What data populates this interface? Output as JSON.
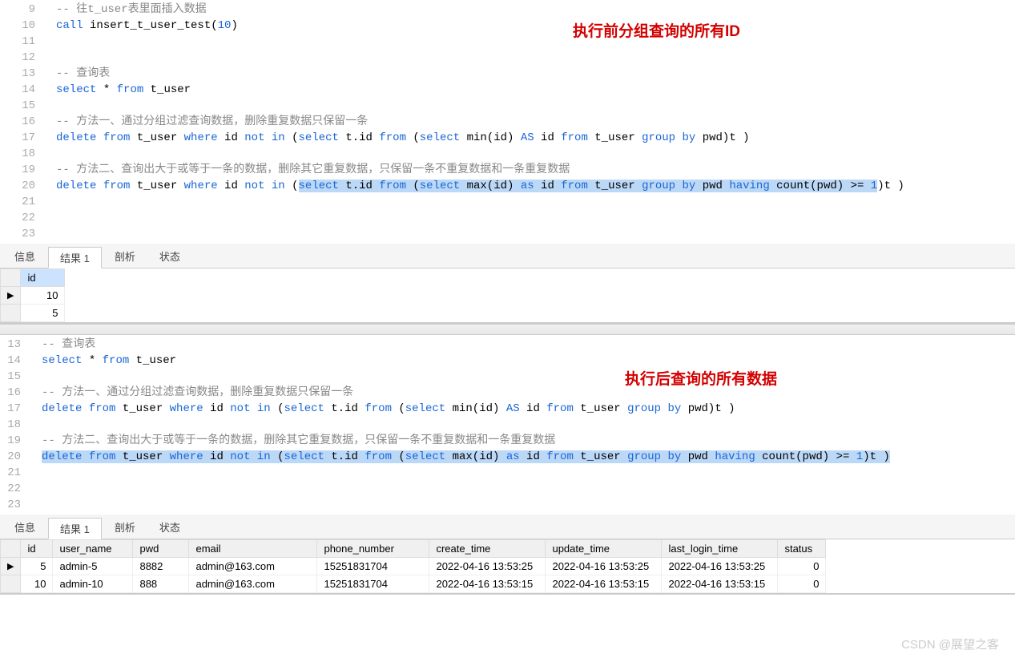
{
  "annotations": {
    "before": "执行前分组查询的所有ID",
    "after": "执行后查询的所有数据"
  },
  "editor1": {
    "lines": {
      "l9": "-- 往t_user表里面插入数据",
      "l10a": "call",
      "l10b": " insert_t_user_test(",
      "l10c": "10",
      "l10d": ")",
      "l13": "-- 查询表",
      "l14_select": "select",
      "l14_star": " * ",
      "l14_from": "from",
      "l14_tuser": " t_user",
      "l16": "-- 方法一、通过分组过滤查询数据，删除重复数据只保留一条",
      "l17_delete": "delete ",
      "l17_from": "from",
      "l17_tuser": " t_user ",
      "l17_where": "where",
      "l17_id": " id ",
      "l17_not": "not",
      "l17_in": " in",
      "l17_paren1": " (",
      "l17_select1": "select",
      "l17_tid": " t.id ",
      "l17_from2": "from",
      "l17_paren2": " (",
      "l17_select2": "select",
      "l17_min": " min(id) ",
      "l17_as": "AS",
      "l17_id2": " id ",
      "l17_from3": "from",
      "l17_tuser2": " t_user ",
      "l17_group": "group",
      "l17_by": " by",
      "l17_pwd": " pwd)t )",
      "l19": "-- 方法二、查询出大于或等于一条的数据，删除其它重复数据，只保留一条不重复数据和一条重复数据",
      "l20_delete": "delete ",
      "l20_from": "from",
      "l20_tuser": " t_user ",
      "l20_where": "where",
      "l20_id": " id ",
      "l20_not": "not",
      "l20_in": " in",
      "l20_paren1": " (",
      "l20_select1": "select",
      "l20_tid": " t.id ",
      "l20_from2": "from",
      "l20_paren2": " (",
      "l20_select2": "select",
      "l20_max": " max(id) ",
      "l20_as": "as",
      "l20_id2": " id ",
      "l20_from3": "from",
      "l20_tuser2": " t_user ",
      "l20_group": "group",
      "l20_by": " by",
      "l20_pwd": " pwd ",
      "l20_having": "having",
      "l20_cnt": " count(pwd) >= ",
      "l20_num1": "1",
      "l20_tail": ")t )"
    }
  },
  "tabs": {
    "info": "信息",
    "result": "结果 1",
    "profile": "剖析",
    "status": "状态"
  },
  "grid1": {
    "header": "id",
    "rows": [
      "10",
      "5"
    ]
  },
  "grid2": {
    "headers": [
      "id",
      "user_name",
      "pwd",
      "email",
      "phone_number",
      "create_time",
      "update_time",
      "last_login_time",
      "status"
    ],
    "rows": [
      {
        "id": "5",
        "user_name": "admin-5",
        "pwd": "8882",
        "email": "admin@163.com",
        "phone_number": "15251831704",
        "create_time": "2022-04-16 13:53:25",
        "update_time": "2022-04-16 13:53:25",
        "last_login_time": "2022-04-16 13:53:25",
        "status": "0"
      },
      {
        "id": "10",
        "user_name": "admin-10",
        "pwd": "888",
        "email": "admin@163.com",
        "phone_number": "15251831704",
        "create_time": "2022-04-16 13:53:15",
        "update_time": "2022-04-16 13:53:15",
        "last_login_time": "2022-04-16 13:53:15",
        "status": "0"
      }
    ]
  },
  "watermark": "CSDN @展望之客"
}
